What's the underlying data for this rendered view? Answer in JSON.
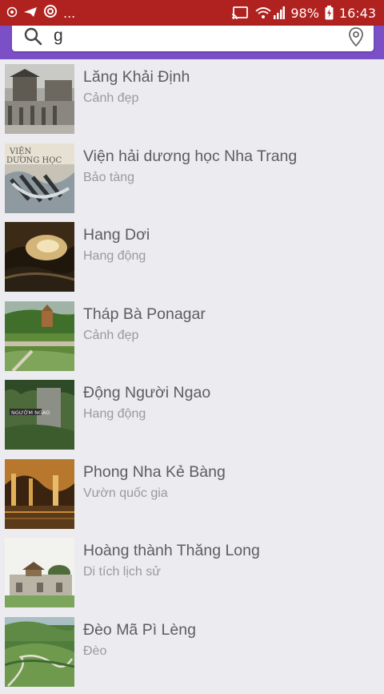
{
  "status_bar": {
    "more_indicator": "...",
    "battery": "98%",
    "time": "16:43",
    "background_color": "#b0221f"
  },
  "header": {
    "background_color": "#7b50c7"
  },
  "search": {
    "value": "g",
    "search_icon": "search-icon",
    "location_icon": "location-pin-icon"
  },
  "places": [
    {
      "name": "Lăng Khải Định",
      "category": "Cảnh đẹp"
    },
    {
      "name": "Viện hải dương học Nha Trang",
      "category": "Bảo tàng"
    },
    {
      "name": "Hang Dơi",
      "category": "Hang động"
    },
    {
      "name": "Tháp Bà Ponagar",
      "category": "Cảnh đẹp"
    },
    {
      "name": "Động Người Ngao",
      "category": "Hang động"
    },
    {
      "name": "Phong Nha Kẻ Bàng",
      "category": "Vườn quốc gia"
    },
    {
      "name": "Hoàng thành Thăng Long",
      "category": "Di tích lịch sử"
    },
    {
      "name": "Đèo Mã Pì Lèng",
      "category": "Đèo"
    }
  ]
}
